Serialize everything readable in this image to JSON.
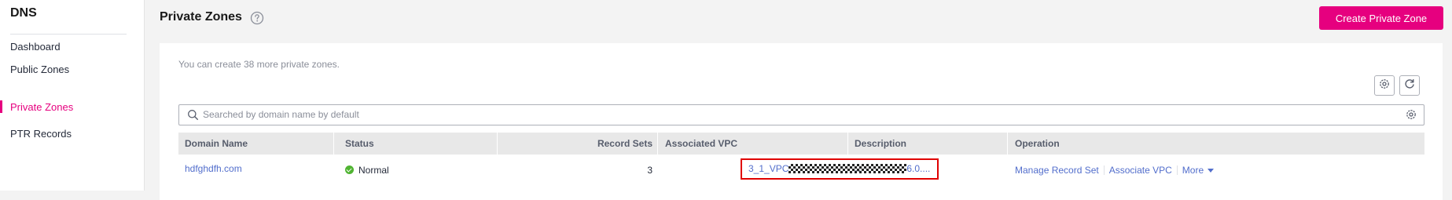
{
  "sidebar": {
    "title": "DNS",
    "items": [
      {
        "label": "Dashboard",
        "active": false
      },
      {
        "label": "Public Zones",
        "active": false
      },
      {
        "label": "Private Zones",
        "active": true
      },
      {
        "label": "PTR Records",
        "active": false
      }
    ]
  },
  "header": {
    "title": "Private Zones",
    "help_icon": "question-circle-icon",
    "create_button": "Create Private Zone"
  },
  "content": {
    "quota_text": "You can create 38 more private zones.",
    "toolbar_icons": [
      "settings-icon",
      "refresh-icon"
    ],
    "search": {
      "placeholder": "Searched by domain name by default",
      "value": ""
    }
  },
  "table": {
    "columns": [
      "Domain Name",
      "Status",
      "Record Sets",
      "Associated VPC",
      "Description",
      "Operation"
    ],
    "rows": [
      {
        "domain": "hdfghdfh.com",
        "status": "Normal",
        "record_sets": "3",
        "vpc_prefix": "3_1_VPC",
        "vpc_suffix": "6.0....",
        "description": "--",
        "operations": [
          "Manage Record Set",
          "Associate VPC",
          "More"
        ]
      }
    ]
  },
  "colors": {
    "accent": "#e6007f",
    "link": "#526ecc",
    "status_normal": "#50b432",
    "highlight_box": "#e00000"
  }
}
